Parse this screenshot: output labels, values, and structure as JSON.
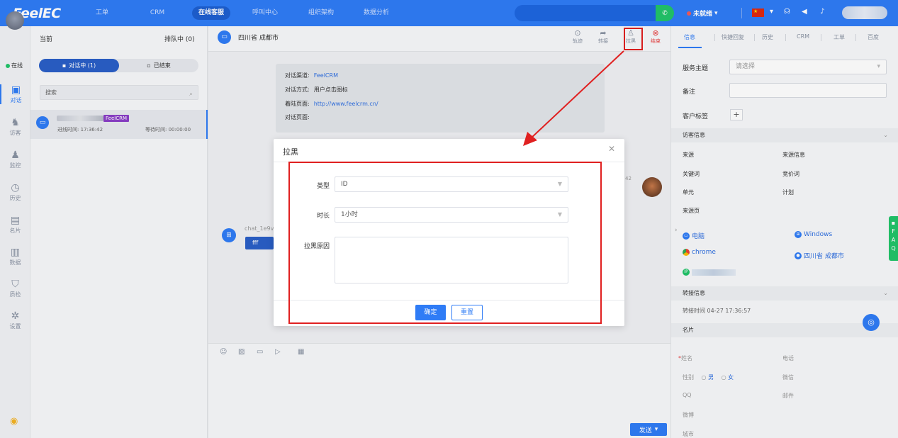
{
  "topbar": {
    "logo": "FeelEC",
    "nav": [
      "工单",
      "CRM",
      "在线客服",
      "呼叫中心",
      "组织架构",
      "数据分析"
    ],
    "active_nav": "在线客服",
    "status": "未就绪",
    "colors": {
      "bar": "#2f7cf6",
      "phone": "#22c46a"
    }
  },
  "leftnav": {
    "online": "在线",
    "items": [
      "对话",
      "访客",
      "监控",
      "历史",
      "名片",
      "数据",
      "质检",
      "设置"
    ],
    "active": "对话"
  },
  "sessions": {
    "title": "当前",
    "queue": "排队中 (0)",
    "tab_active": "对话中 (1)",
    "tab_done": "已结束",
    "search_placeholder": "搜索",
    "item": {
      "tag": "FeelCRM",
      "enter_time": "进线时间: 17:36:42",
      "wait_time": "等待时间: 00:00:00"
    }
  },
  "chat": {
    "location": "四川省 成都市",
    "tools": [
      "轨迹",
      "转接",
      "拉黑",
      "结束"
    ],
    "info": [
      {
        "k": "对话渠道:",
        "v": "FeelCRM"
      },
      {
        "k": "对话方式:",
        "v": "用户点击图标"
      },
      {
        "k": "着陆页面:",
        "v": "http://www.feelcrm.cn/"
      },
      {
        "k": "对话页面:",
        "v": ""
      }
    ],
    "msg_time_right": "42",
    "visitor_id": "chat_1e9v",
    "visitor_msg": "fff",
    "send": "发送"
  },
  "right": {
    "tabs": [
      "信息",
      "快捷回复",
      "历史",
      "CRM",
      "工单",
      "百度"
    ],
    "service_topic_label": "服务主题",
    "service_topic_placeholder": "请选择",
    "remark_label": "备注",
    "customer_tag_label": "客户标签",
    "visitor_section": "访客信息",
    "visitor_kv": [
      [
        "来源",
        "来源信息"
      ],
      [
        "关键词",
        "竞价词"
      ],
      [
        "单元",
        "计划"
      ],
      [
        "来源页",
        ""
      ]
    ],
    "device": "电脑",
    "os": "Windows",
    "browser": "chrome",
    "region": "四川省 成都市",
    "ip_label": "IP",
    "transfer_section": "转接信息",
    "transfer_time": "转接时间 04-27 17:36:57",
    "card_section": "名片",
    "form": {
      "name": "姓名",
      "phone": "电话",
      "gender": "性别",
      "male": "男",
      "female": "女",
      "wechat": "微信",
      "qq": "QQ",
      "email": "邮件",
      "weibo": "微博",
      "city": "城市"
    },
    "faq": [
      "F",
      "A",
      "Q"
    ]
  },
  "modal": {
    "title": "拉黑",
    "type_label": "类型",
    "type_value": "ID",
    "duration_label": "时长",
    "duration_value": "1小时",
    "reason_label": "拉黑原因",
    "ok": "确定",
    "reset": "重置"
  }
}
